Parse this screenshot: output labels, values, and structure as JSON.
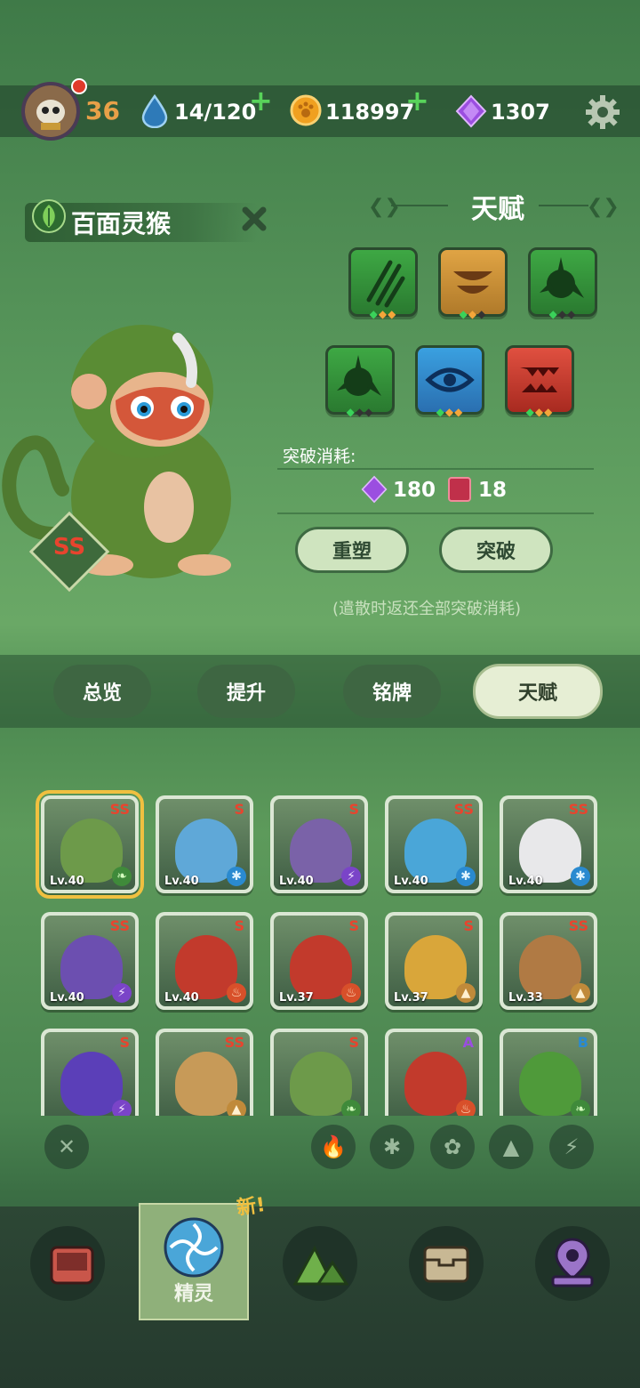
{
  "topbar": {
    "level": "36",
    "energy": "14/120",
    "coins": "118997",
    "gems": "1307"
  },
  "pet": {
    "name": "百面灵猴",
    "grade": "SS"
  },
  "talent": {
    "title": "天赋",
    "cost_label": "突破消耗:",
    "cost_gems": "180",
    "cost_books": "18",
    "reforge_label": "重塑",
    "breakthrough_label": "突破",
    "hint": "(遣散时返还全部突破消耗)"
  },
  "tabs": [
    "总览",
    "提升",
    "铭牌",
    "天赋"
  ],
  "pets": [
    {
      "grade": "SS",
      "level": "Lv.40",
      "color": "#6d9a4a",
      "elem": "leaf"
    },
    {
      "grade": "S",
      "level": "Lv.40",
      "color": "#5fa8d8",
      "elem": "ice"
    },
    {
      "grade": "S",
      "level": "Lv.40",
      "color": "#7a62a8",
      "elem": "bolt"
    },
    {
      "grade": "SS",
      "level": "Lv.40",
      "color": "#4aa6d8",
      "elem": "ice"
    },
    {
      "grade": "SS",
      "level": "Lv.40",
      "color": "#e8e8ea",
      "elem": "ice"
    },
    {
      "grade": "SS",
      "level": "Lv.40",
      "color": "#6c4fb0",
      "elem": "bolt"
    },
    {
      "grade": "S",
      "level": "Lv.40",
      "color": "#c23a2c",
      "elem": "fire"
    },
    {
      "grade": "S",
      "level": "Lv.37",
      "color": "#c23a2c",
      "elem": "fire"
    },
    {
      "grade": "S",
      "level": "Lv.37",
      "color": "#d9a63a",
      "elem": "earth"
    },
    {
      "grade": "SS",
      "level": "Lv.33",
      "color": "#b07a44",
      "elem": "earth"
    },
    {
      "grade": "S",
      "level": "",
      "color": "#5b3fb8",
      "elem": "bolt"
    },
    {
      "grade": "SS",
      "level": "",
      "color": "#c79a58",
      "elem": "earth"
    },
    {
      "grade": "S",
      "level": "",
      "color": "#6d9a4a",
      "elem": "leaf"
    },
    {
      "grade": "A",
      "level": "",
      "color": "#c23a2c",
      "elem": "fire"
    },
    {
      "grade": "B",
      "level": "",
      "color": "#4f9a3a",
      "elem": "leaf"
    }
  ],
  "nav": {
    "new_badge": "新!",
    "active_label": "精灵"
  },
  "icons": {
    "energy": "water-drop-icon",
    "coin": "paw-coin-icon",
    "gem": "purple-gem-icon",
    "settings": "gear-icon"
  }
}
